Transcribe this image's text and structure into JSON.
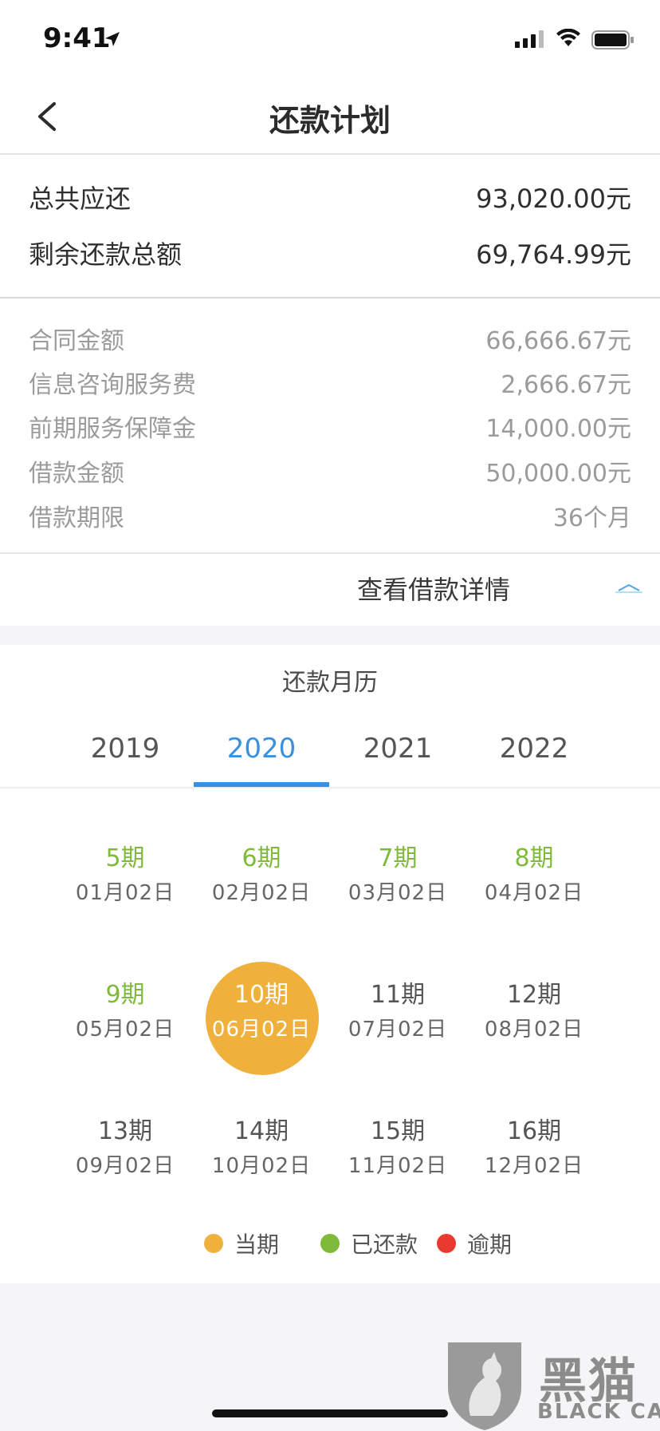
{
  "status_bar": {
    "time": "9:41"
  },
  "nav": {
    "title": "还款计划"
  },
  "summary": [
    {
      "label": "总共应还",
      "value": "93,020.00元"
    },
    {
      "label": "剩余还款总额",
      "value": "69,764.99元"
    }
  ],
  "details": [
    {
      "label": "合同金额",
      "value": "66,666.67元"
    },
    {
      "label": "信息咨询服务费",
      "value": "2,666.67元"
    },
    {
      "label": "前期服务保障金",
      "value": "14,000.00元"
    },
    {
      "label": "借款金额",
      "value": "50,000.00元"
    },
    {
      "label": "借款期限",
      "value": "36个月"
    }
  ],
  "detail_link": {
    "label": "查看借款详情"
  },
  "calendar": {
    "title": "还款月历",
    "years": [
      "2019",
      "2020",
      "2021",
      "2022"
    ],
    "active_year": "2020",
    "installments": [
      {
        "period": "5期",
        "date": "01月02日",
        "status": "paid"
      },
      {
        "period": "6期",
        "date": "02月02日",
        "status": "paid"
      },
      {
        "period": "7期",
        "date": "03月02日",
        "status": "paid"
      },
      {
        "period": "8期",
        "date": "04月02日",
        "status": "paid"
      },
      {
        "period": "9期",
        "date": "05月02日",
        "status": "paid"
      },
      {
        "period": "10期",
        "date": "06月02日",
        "status": "current"
      },
      {
        "period": "11期",
        "date": "07月02日",
        "status": "upcoming"
      },
      {
        "period": "12期",
        "date": "08月02日",
        "status": "upcoming"
      },
      {
        "period": "13期",
        "date": "09月02日",
        "status": "upcoming"
      },
      {
        "period": "14期",
        "date": "10月02日",
        "status": "upcoming"
      },
      {
        "period": "15期",
        "date": "11月02日",
        "status": "upcoming"
      },
      {
        "period": "16期",
        "date": "12月02日",
        "status": "upcoming"
      }
    ],
    "legend": [
      {
        "label": "当期",
        "color": "#efb13c"
      },
      {
        "label": "已还款",
        "color": "#7fba3b"
      },
      {
        "label": "逾期",
        "color": "#e83a2f"
      }
    ]
  },
  "colors": {
    "accent": "#3a8fde",
    "current": "#efb13c",
    "paid": "#7fba3b",
    "overdue": "#e83a2f"
  },
  "watermark": {
    "text": "黑猫",
    "sub": "BLACK CAT"
  }
}
